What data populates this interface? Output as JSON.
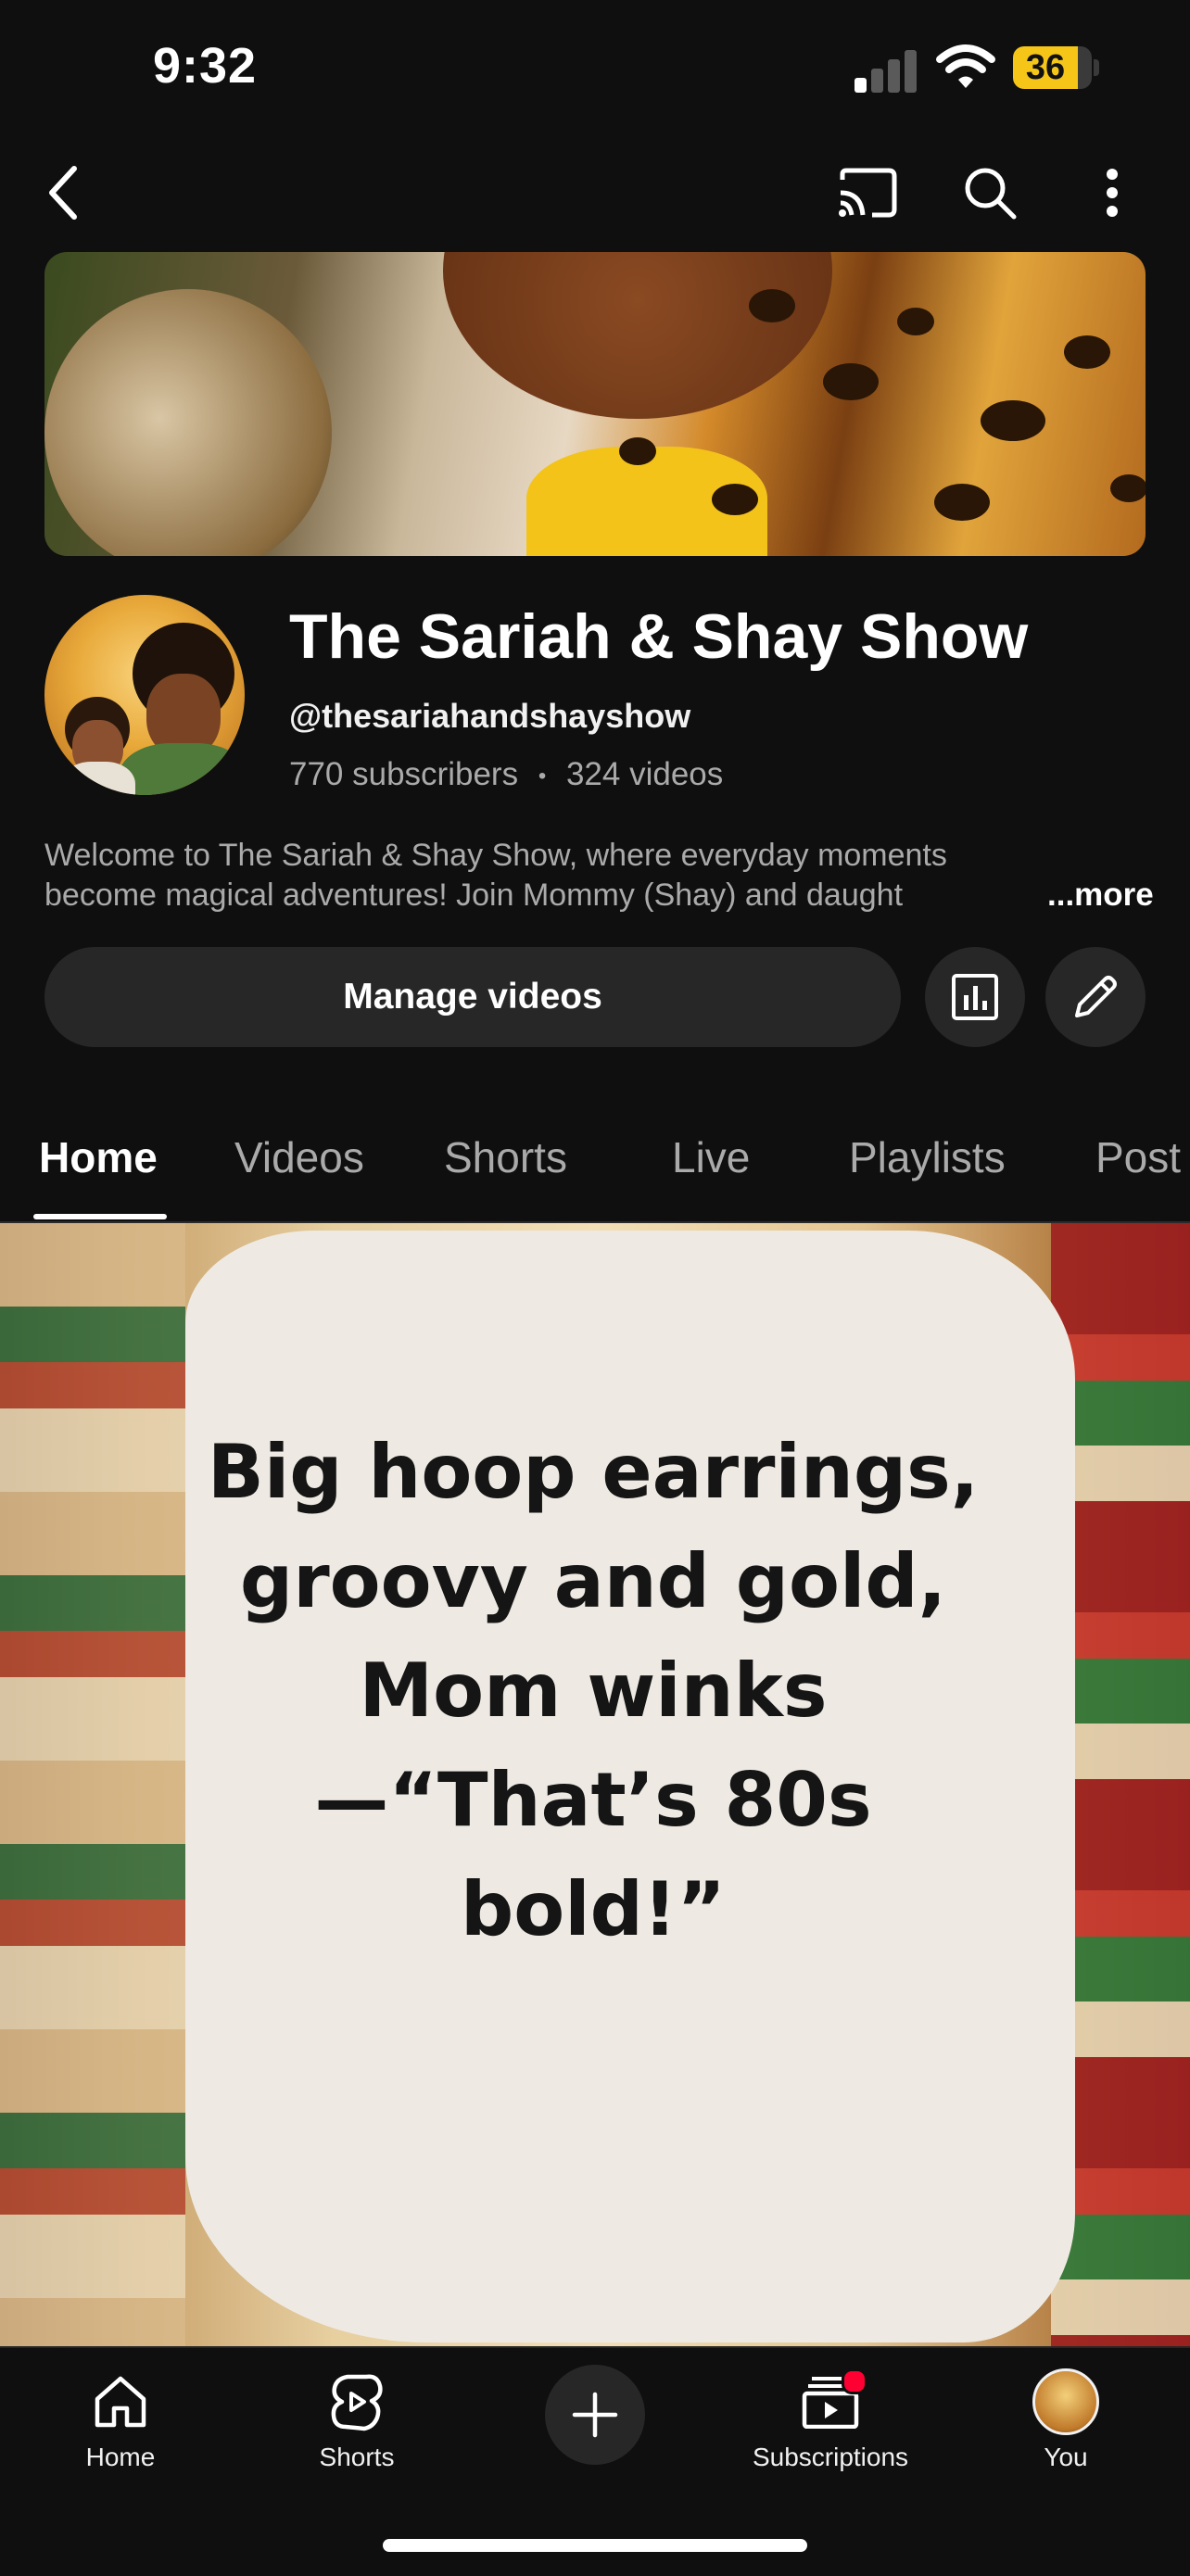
{
  "status_bar": {
    "time": "9:32",
    "battery": "36"
  },
  "top_nav": {
    "icons": [
      "back-icon",
      "cast-icon",
      "search-icon",
      "more-vert-icon"
    ]
  },
  "channel": {
    "title": "The Sariah & Shay Show",
    "handle": "@thesariahandshayshow",
    "subscribers": "770 subscribers",
    "separator": "•",
    "videos": "324 videos",
    "description_line1": "Welcome to The Sariah & Shay Show, where everyday moments",
    "description_line2": "become magical adventures! Join Mommy (Shay) and daught",
    "more_label": "...more"
  },
  "actions": {
    "manage_label": "Manage videos",
    "analytics_icon": "analytics-icon",
    "edit_icon": "edit-pencil-icon"
  },
  "tabs": [
    {
      "label": "Home",
      "active": true
    },
    {
      "label": "Videos"
    },
    {
      "label": "Shorts"
    },
    {
      "label": "Live"
    },
    {
      "label": "Playlists"
    },
    {
      "label": "Post"
    }
  ],
  "featured": {
    "lines": [
      "Big hoop earrings,",
      "groovy and gold,",
      "Mom winks",
      "—“That’s 80s",
      "bold!”"
    ]
  },
  "bottom_nav": {
    "items": [
      {
        "label": "Home",
        "icon": "home-icon"
      },
      {
        "label": "Shorts",
        "icon": "shorts-icon"
      },
      {
        "label": "",
        "icon": "create-plus-icon"
      },
      {
        "label": "Subscriptions",
        "icon": "subscriptions-icon"
      },
      {
        "label": "You",
        "icon": "you-avatar"
      }
    ]
  },
  "colors": {
    "background": "#0f0f0f",
    "surface": "#272727",
    "muted_text": "#aaaaaa",
    "notification": "#ff0033",
    "battery": "#f5c518"
  }
}
